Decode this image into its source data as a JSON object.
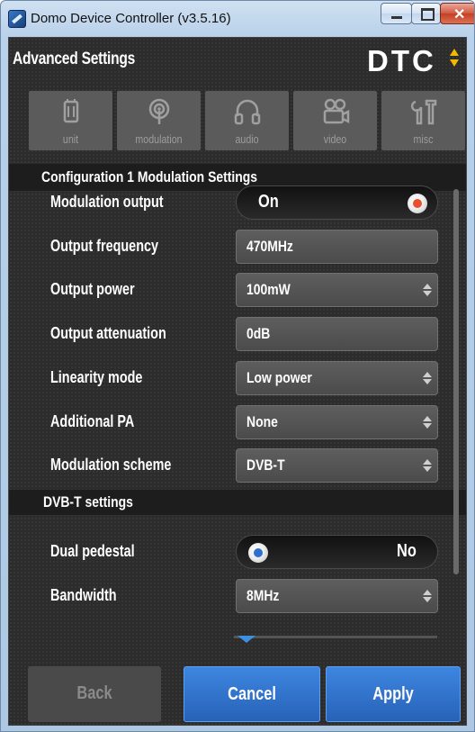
{
  "window": {
    "title": "Domo Device Controller (v3.5.16)"
  },
  "header": {
    "title": "Advanced Settings",
    "logo": "DTC"
  },
  "tabs": [
    {
      "label": "unit",
      "icon": "unit-icon"
    },
    {
      "label": "modulation",
      "icon": "modulation-icon"
    },
    {
      "label": "audio",
      "icon": "headphones-icon"
    },
    {
      "label": "video",
      "icon": "video-camera-icon"
    },
    {
      "label": "misc",
      "icon": "wrench-icon"
    }
  ],
  "sections": {
    "modulation": "Configuration 1 Modulation Settings",
    "dvbt": "DVB-T settings"
  },
  "settings": [
    {
      "label": "Modulation output",
      "type": "toggle",
      "value": "On"
    },
    {
      "label": "Output frequency",
      "type": "input",
      "value": "470MHz"
    },
    {
      "label": "Output power",
      "type": "select",
      "value": "100mW"
    },
    {
      "label": "Output attenuation",
      "type": "input",
      "value": "0dB"
    },
    {
      "label": "Linearity mode",
      "type": "select",
      "value": "Low power"
    },
    {
      "label": "Additional PA",
      "type": "select",
      "value": "None"
    },
    {
      "label": "Modulation scheme",
      "type": "select",
      "value": "DVB-T"
    }
  ],
  "dvbt_settings": [
    {
      "label": "Dual pedestal",
      "type": "toggle",
      "value": "No"
    },
    {
      "label": "Bandwidth",
      "type": "select",
      "value": "8MHz"
    }
  ],
  "footer": {
    "back": "Back",
    "cancel": "Cancel",
    "apply": "Apply"
  },
  "colors": {
    "accent": "#2f72cc",
    "toggle_on": "#e8502e",
    "toggle_off": "#2f6fd0",
    "logo_arrows": "#f2b800"
  }
}
